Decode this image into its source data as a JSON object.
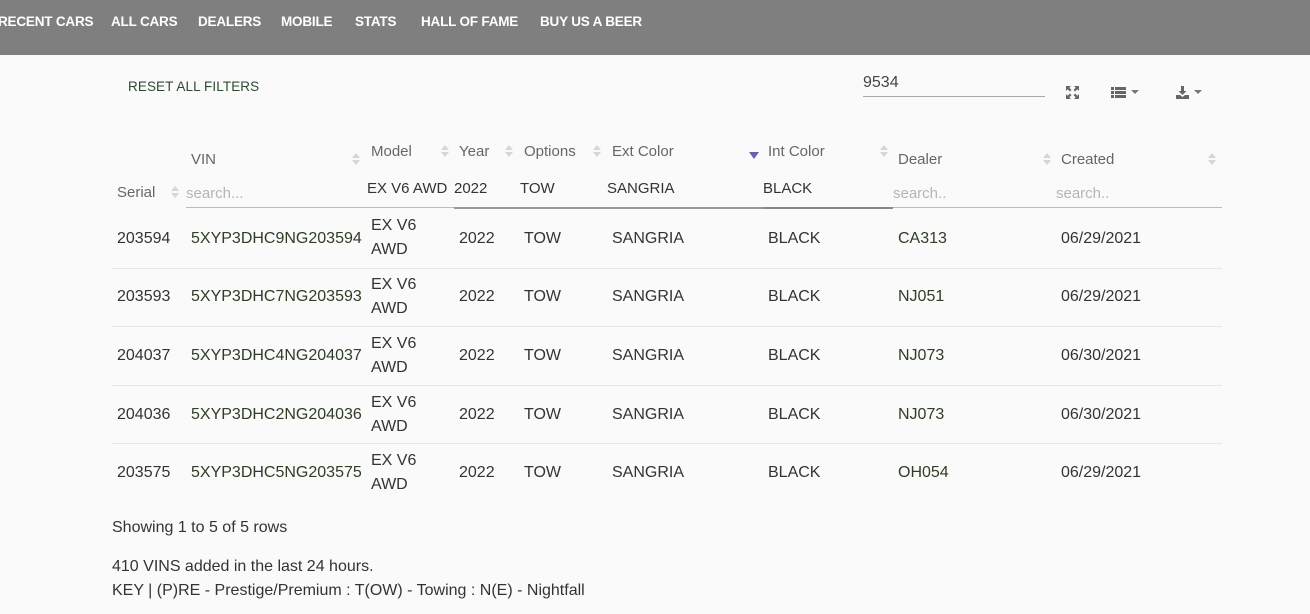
{
  "nav": {
    "items": [
      "RECENT CARS",
      "ALL CARS",
      "DEALERS",
      "MOBILE",
      "STATS",
      "HALL OF FAME",
      "BUY US A BEER"
    ]
  },
  "toolbar": {
    "reset_label": "RESET ALL FILTERS",
    "search_value": "9534",
    "fullscreen_icon": "fullscreen-icon",
    "columns_icon": "list-icon",
    "export_icon": "download-icon"
  },
  "table": {
    "headers": {
      "serial": "Serial",
      "vin": "VIN",
      "model": "Model",
      "year": "Year",
      "options": "Options",
      "ext_color": "Ext Color",
      "int_color": "Int Color",
      "dealer": "Dealer",
      "created": "Created"
    },
    "filters": {
      "vin_placeholder": "search...",
      "model": "EX V6 AWD",
      "year": "2022",
      "options": "TOW",
      "ext_color": "SANGRIA",
      "int_color": "BLACK",
      "dealer_placeholder": "search..",
      "created_placeholder": "search.."
    },
    "sorted_column": "Int Color",
    "sort_direction": "desc",
    "accent_color": "#6b5fb0",
    "rows": [
      {
        "serial": "203594",
        "vin": "5XYP3DHC9NG203594",
        "model_1": "EX V6",
        "model_2": "AWD",
        "year": "2022",
        "options": "TOW",
        "ext": "SANGRIA",
        "int": "BLACK",
        "dealer": "CA313",
        "created": "06/29/2021"
      },
      {
        "serial": "203593",
        "vin": "5XYP3DHC7NG203593",
        "model_1": "EX V6",
        "model_2": "AWD",
        "year": "2022",
        "options": "TOW",
        "ext": "SANGRIA",
        "int": "BLACK",
        "dealer": "NJ051",
        "created": "06/29/2021"
      },
      {
        "serial": "204037",
        "vin": "5XYP3DHC4NG204037",
        "model_1": "EX V6",
        "model_2": "AWD",
        "year": "2022",
        "options": "TOW",
        "ext": "SANGRIA",
        "int": "BLACK",
        "dealer": "NJ073",
        "created": "06/30/2021"
      },
      {
        "serial": "204036",
        "vin": "5XYP3DHC2NG204036",
        "model_1": "EX V6",
        "model_2": "AWD",
        "year": "2022",
        "options": "TOW",
        "ext": "SANGRIA",
        "int": "BLACK",
        "dealer": "NJ073",
        "created": "06/30/2021"
      },
      {
        "serial": "203575",
        "vin": "5XYP3DHC5NG203575",
        "model_1": "EX V6",
        "model_2": "AWD",
        "year": "2022",
        "options": "TOW",
        "ext": "SANGRIA",
        "int": "BLACK",
        "dealer": "OH054",
        "created": "06/29/2021"
      }
    ]
  },
  "footer": {
    "pagination_info": "Showing 1 to 5 of 5 rows",
    "vins_added": "410 VINS added in the last 24 hours.",
    "key": "KEY | (P)RE - Prestige/Premium : T(OW) - Towing : N(E) - Nightfall"
  }
}
